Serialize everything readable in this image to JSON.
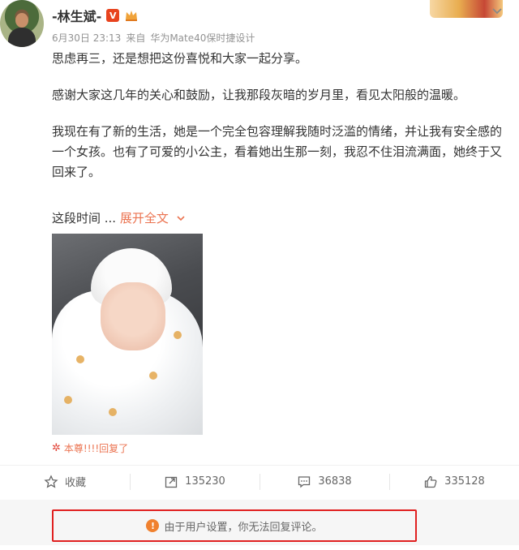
{
  "post": {
    "author": "-林生斌-",
    "verified_badge": "V",
    "date": "6月30日 23:13",
    "source_prefix": "来自",
    "device": "华为Mate40保时捷设计",
    "paragraphs": [
      "思虑再三，还是想把这份喜悦和大家一起分享。",
      "感谢大家这几年的关心和鼓励，让我那段灰暗的岁月里，看见太阳般的温暖。",
      "我现在有了新的生活，她是一个完全包容理解我随时泛滥的情绪，并让我有安全感的一个女孩。也有了可爱的小公主，看着她出生那一刻，我忍不住泪流满面，她终于又回来了。"
    ],
    "truncated_text": "这段时间 ...",
    "expand_label": "展开全文",
    "reply_note": "本尊!!!!回复了"
  },
  "actions": {
    "favorite_label": "收藏",
    "repost_count": "135230",
    "comment_count": "36838",
    "like_count": "335128"
  },
  "notice": {
    "text": "由于用户设置，你无法回复评论。"
  },
  "colors": {
    "accent": "#eb7350",
    "highlight_border": "#e02020",
    "warning": "#f0812f"
  }
}
